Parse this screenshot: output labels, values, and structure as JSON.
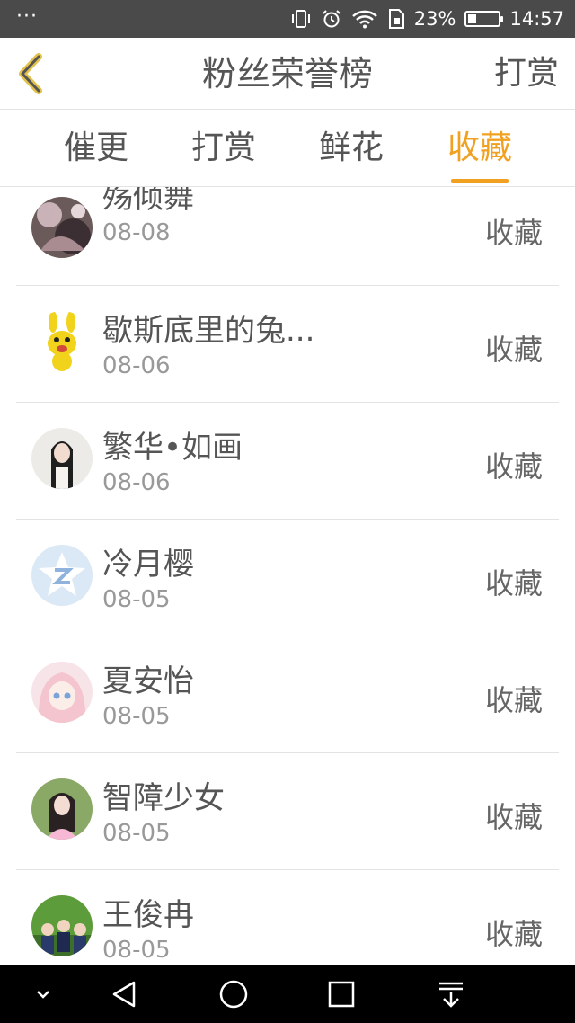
{
  "status_bar": {
    "dots": "···",
    "battery_percent": "23%",
    "battery_level": 0.23,
    "time": "14:57"
  },
  "header": {
    "title": "粉丝荣誉榜",
    "right_action": "打赏"
  },
  "tabs": [
    {
      "label": "催更",
      "active": false
    },
    {
      "label": "打赏",
      "active": false
    },
    {
      "label": "鲜花",
      "active": false
    },
    {
      "label": "收藏",
      "active": true
    }
  ],
  "accent_color": "#f0a122",
  "list": [
    {
      "name": "殇倾舞",
      "date": "08-08",
      "action": "收藏",
      "avatar": "dark-anime-avatar"
    },
    {
      "name": "歇斯底里的兔...",
      "date": "08-06",
      "action": "收藏",
      "avatar": "yellow-rabbit-avatar"
    },
    {
      "name": "繁华•如画",
      "date": "08-06",
      "action": "收藏",
      "avatar": "girl-photo-avatar"
    },
    {
      "name": "冷月樱",
      "date": "08-05",
      "action": "收藏",
      "avatar": "default-qq-avatar"
    },
    {
      "name": "夏安怡",
      "date": "08-05",
      "action": "收藏",
      "avatar": "anime-girl-avatar"
    },
    {
      "name": "智障少女",
      "date": "08-05",
      "action": "收藏",
      "avatar": "girl-garden-avatar"
    },
    {
      "name": "王俊冉",
      "date": "08-05",
      "action": "收藏",
      "avatar": "kids-photo-avatar"
    }
  ]
}
